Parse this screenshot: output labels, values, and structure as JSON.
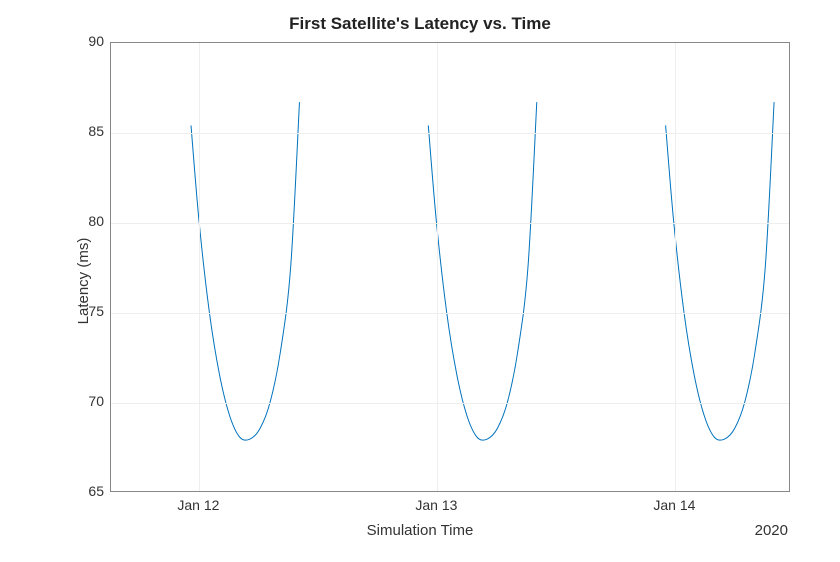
{
  "chart_data": {
    "type": "line",
    "title": "First Satellite's Latency vs. Time",
    "xlabel": "Simulation Time",
    "ylabel": "Latency (ms)",
    "year": "2020",
    "ylim": [
      65,
      90
    ],
    "yticks": [
      65,
      70,
      75,
      80,
      85,
      90
    ],
    "xticks": [
      "Jan 12",
      "Jan 13",
      "Jan 14"
    ],
    "xtick_frac": [
      0.13,
      0.48,
      0.83
    ],
    "series": [
      {
        "name": "latency",
        "segments": [
          {
            "x_frac": [
              0.118,
              0.13,
              0.145,
              0.16,
              0.175,
              0.19,
              0.205,
              0.22,
              0.235,
              0.25,
              0.265,
              0.278
            ],
            "y": [
              85.4,
              80.0,
              75.0,
              71.5,
              69.2,
              68.0,
              67.9,
              68.5,
              70.0,
              72.8,
              77.5,
              86.7
            ]
          },
          {
            "x_frac": [
              0.468,
              0.48,
              0.495,
              0.51,
              0.525,
              0.54,
              0.555,
              0.57,
              0.585,
              0.6,
              0.615,
              0.628
            ],
            "y": [
              85.4,
              80.0,
              75.0,
              71.5,
              69.2,
              68.0,
              67.9,
              68.5,
              70.0,
              72.8,
              77.5,
              86.7
            ]
          },
          {
            "x_frac": [
              0.818,
              0.83,
              0.845,
              0.86,
              0.875,
              0.89,
              0.905,
              0.92,
              0.935,
              0.95,
              0.965,
              0.978
            ],
            "y": [
              85.4,
              80.0,
              75.0,
              71.5,
              69.2,
              68.0,
              67.9,
              68.5,
              70.0,
              72.8,
              77.5,
              86.7
            ]
          }
        ]
      }
    ]
  }
}
